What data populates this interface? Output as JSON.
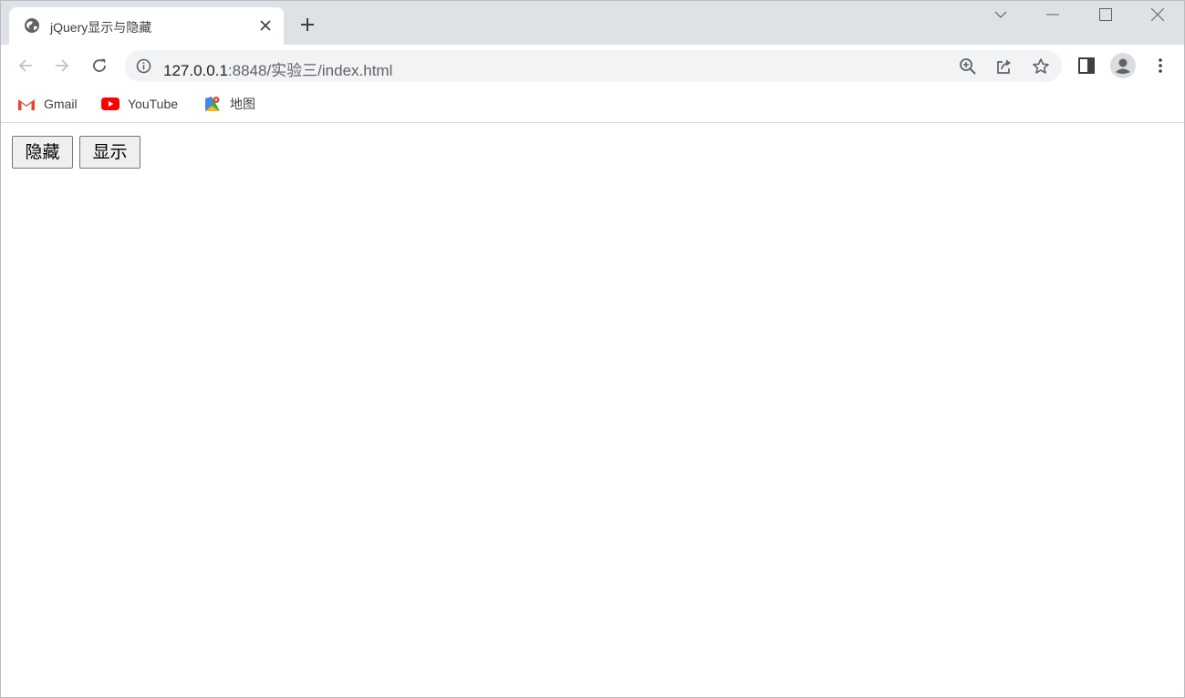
{
  "tab": {
    "title": "jQuery显示与隐藏",
    "favicon": "globe-icon",
    "close_icon": "close-icon"
  },
  "window_controls": [
    "chevron-down-icon",
    "minimize-icon",
    "maximize-icon",
    "close-icon"
  ],
  "toolbar": {
    "back_icon": "back-arrow-icon",
    "forward_icon": "forward-arrow-icon",
    "reload_icon": "reload-icon",
    "url_host": "127.0.0.1",
    "url_rest": ":8848/实验三/index.html",
    "omnibox_icons": [
      "zoom-icon",
      "share-icon",
      "star-icon"
    ],
    "right_icons": [
      "side-panel-icon",
      "profile-icon",
      "kebab-menu-icon"
    ]
  },
  "bookmarks": [
    {
      "label": "Gmail",
      "icon": "gmail-icon"
    },
    {
      "label": "YouTube",
      "icon": "youtube-icon"
    },
    {
      "label": "地图",
      "icon": "maps-icon"
    }
  ],
  "page": {
    "hide_button": "隐藏",
    "show_button": "显示"
  },
  "colors": {
    "tabstrip": "#dee1e6",
    "omnibox": "#f1f3f4",
    "icon": "#5f6368",
    "youtube_red": "#ff0000",
    "gmail_red": "#ea4335"
  }
}
